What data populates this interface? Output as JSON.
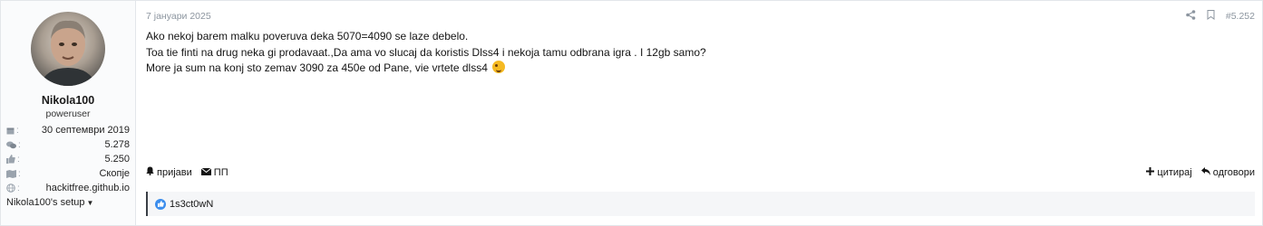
{
  "user": {
    "name": "Nikola100",
    "title": "poweruser",
    "joined": "30 септември 2019",
    "messages": "5.278",
    "reactions": "5.250",
    "location": "Скопје",
    "website": "hackitfree.github.io",
    "setup_label": "Nikola100's setup"
  },
  "post": {
    "date": "7 јануари 2025",
    "number": "#5.252",
    "lines": [
      "Ako nekoj barem malku poveruva deka 5070=4090 se laze debelo.",
      "Toa tie finti na drug neka gi prodavaat.,Da ama vo slucaj da koristis Dlss4 i nekoja tamu odbrana igra . I 12gb samo?",
      "More ja sum na konj sto zemav 3090 za 450e od Pane, vie vrtete dlss4"
    ]
  },
  "actions": {
    "report": "пријави",
    "pm": "ПП",
    "quote": "цитирај",
    "reply": "одговори"
  },
  "reactions": {
    "users": "1s3ct0wN"
  },
  "icons": {
    "share": "share-icon",
    "bookmark": "bookmark-icon",
    "calendar": "calendar-icon",
    "messages": "comments-icon",
    "likes": "thumbs-up-icon",
    "location": "map-icon",
    "website": "globe-icon",
    "report": "bell-icon",
    "pm": "envelope-icon",
    "quote": "plus-icon",
    "reply": "reply-icon"
  },
  "colors": {
    "like": "#3b8ded",
    "emoji": "#f5b922"
  }
}
